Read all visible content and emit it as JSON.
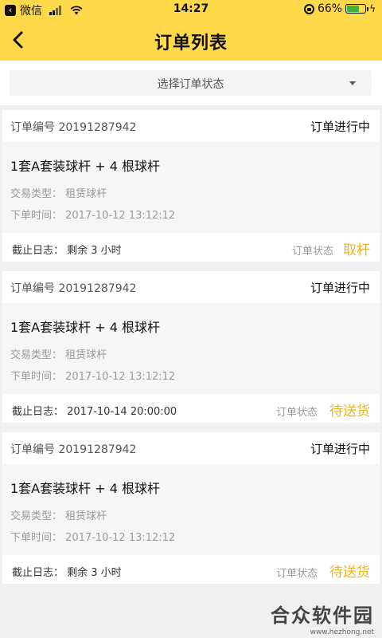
{
  "status_bar": {
    "carrier": "微信",
    "time": "14:27",
    "battery": "66%",
    "battery_level": 0.66,
    "battery_color": "#3db33d"
  },
  "nav": {
    "title": "订单列表",
    "background": "#ffd94a"
  },
  "filter": {
    "label": "选择订单状态"
  },
  "orders": [
    {
      "order_no": "订单编号 20191287942",
      "status": "订单进行中",
      "product": "1套A套装球杆 + 4 根球杆",
      "trade_type": "交易类型：  租赁球杆",
      "order_time": "下单时间：  2017-10-12 13:12:12",
      "deadline": "截止日志：  剩余 3 小时",
      "status_label": "订单状态",
      "action": "取杆"
    },
    {
      "order_no": "订单编号 20191287942",
      "status": "订单进行中",
      "product": "1套A套装球杆 + 4 根球杆",
      "trade_type": "交易类型：  租赁球杆",
      "order_time": "下单时间：  2017-10-12 13:12:12",
      "deadline": "截止日志：  2017-10-14 20:00:00",
      "status_label": "订单状态",
      "action": "待送货"
    },
    {
      "order_no": "订单编号 20191287942",
      "status": "订单进行中",
      "product": "1套A套装球杆 + 4 根球杆",
      "trade_type": "交易类型：  租赁球杆",
      "order_time": "下单时间：  2017-10-12 13:12:12",
      "deadline": "截止日志：  剩余 3 小时",
      "status_label": "订单状态",
      "action": "待送货"
    }
  ],
  "watermark": {
    "name": "合众软件园",
    "url": "www.hezhong.net"
  },
  "colors": {
    "accent": "#f3b31b",
    "header": "#ffd94a"
  }
}
